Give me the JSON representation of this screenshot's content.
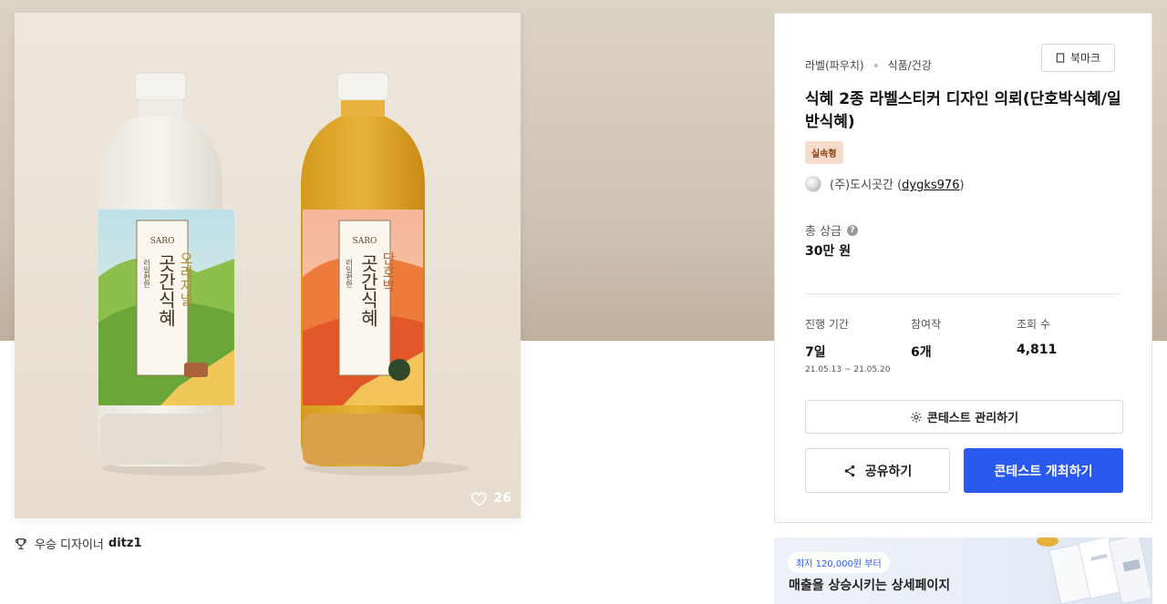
{
  "artwork": {
    "likes": "26",
    "bottle_left": {
      "brand": "SARO",
      "sub": "러일편한",
      "name": "곳간식혜",
      "flavor": "오리지널"
    },
    "bottle_right": {
      "brand": "SARO",
      "sub": "러일편한",
      "name": "곳간식혜",
      "flavor": "단호박"
    }
  },
  "winner": {
    "label": "우승 디자이너",
    "name": "ditz1"
  },
  "panel": {
    "category1": "라벨(파우치)",
    "category2": "식품/건강",
    "bookmark": "북마크",
    "title": "식혜 2종 라벨스티커 디자인 의뢰(단호박식혜/일반식혜)",
    "tag": "실속형",
    "host_name": "(주)도시곳간 (",
    "host_id": "dygks976",
    "host_close": ")",
    "prize_label": "총 상금",
    "prize_value": "30만 원",
    "stats": [
      {
        "label": "진행 기간",
        "value": "7일",
        "sub": "21.05.13 ~ 21.05.20"
      },
      {
        "label": "참여작",
        "value": "6개",
        "sub": ""
      },
      {
        "label": "조회 수",
        "value": "4,811",
        "sub": ""
      }
    ],
    "manage_button": "콘테스트 관리하기",
    "share_button": "공유하기",
    "host_button": "콘테스트 개최하기"
  },
  "ad": {
    "pill": "최저 120,000원 부터",
    "headline": "매출을 상승시키는 상세페이지"
  },
  "colors": {
    "primary": "#2a59f0",
    "tag_bg": "#f8dccb",
    "tag_text": "#8a3d12"
  }
}
